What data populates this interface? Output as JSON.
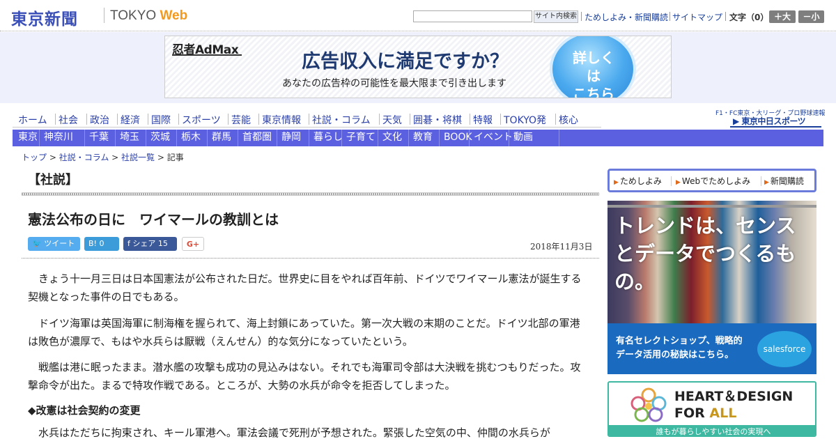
{
  "header": {
    "logo_jp": "東京新聞",
    "logo_en": "TOKYO ",
    "logo_web": "Web",
    "search_button": "サイト内検索",
    "links": [
      "ためしよみ・新聞購読",
      "サイトマップ"
    ],
    "font_label": "文字（0）",
    "font_larger": "＋大",
    "font_smaller": "－小"
  },
  "ad_banner": {
    "brand": "忍者AdMax",
    "headline": "広告収入に満足ですか？",
    "subline": "あなたの広告枠の可能性を最大限まで引き出します",
    "cta_line1": "詳しくは",
    "cta_line2": "こちら"
  },
  "nav_primary": [
    "ホーム",
    "社会",
    "政治",
    "経済",
    "国際",
    "スポーツ",
    "芸能",
    "東京情報",
    "社説・コラム",
    "天気",
    "囲碁・将棋",
    "特報",
    "TOKYO発",
    "核心"
  ],
  "chunichi": {
    "tagline": "F1・FC東京・大リーグ・プロ野球速報",
    "logo": "▶ 東京中日スポーツ"
  },
  "nav_secondary": [
    "東京",
    "神奈川",
    "千葉",
    "埼玉",
    "茨城",
    "栃木",
    "群馬",
    "首都圏",
    "静岡",
    "暮らし",
    "子育て",
    "文化",
    "教育",
    "BOOK",
    "イベント",
    "動画"
  ],
  "breadcrumb": {
    "items": [
      "トップ",
      "社説・コラム",
      "社説一覧"
    ],
    "separator": " > ",
    "current": "記事"
  },
  "article": {
    "section": "【社説】",
    "title": "憲法公布の日に　ワイマールの教訓とは",
    "date": "2018年11月3日",
    "share": {
      "tweet": "ツイート",
      "hatena": "B! 0",
      "facebook": "f シェア 15",
      "gplus": "G+"
    },
    "paragraphs": [
      "　きょう十一月三日は日本国憲法が公布された日だ。世界史に目をやれば百年前、ドイツでワイマール憲法が誕生する契機となった事件の日でもある。",
      "　ドイツ海軍は英国海軍に制海権を握られて、海上封鎖にあっていた。第一次大戦の末期のことだ。ドイツ北部の軍港は敗色が濃厚で、もはや水兵らは厭戦（えんせん）的な気分になっていたという。",
      "　戦艦は港に眠ったまま。潜水艦の攻撃も成功の見込みはない。それでも海軍司令部は大決戦を挑むつもりだった。攻撃命令が出た。まるで特攻作戦である。ところが、大勢の水兵が命令を拒否してしまった。",
      "　水兵はただちに拘束され、キール軍港へ。軍法会議で死刑が予想された。緊張した空気の中、仲間の水兵らが"
    ],
    "subheading": "◆改憲は社会契約の変更"
  },
  "sidebar": {
    "tabs": [
      "ためしよみ",
      "Webでためしよみ",
      "新聞購読"
    ],
    "ad_trend": {
      "headline": "トレンドは、センスとデータでつくるもの。",
      "body": "有名セレクトショップ、戦略的データ活用の秘訣はこちら。",
      "brand": "salesforce"
    },
    "ad_heart": {
      "line1": "HEART＆DESIGN",
      "line2_a": "FOR ",
      "line2_b": "ALL",
      "bar": "誰もが暮らしやすい社会の実現へ"
    }
  },
  "colors": {
    "logo_blue": "#3a4fb8",
    "nav_bar": "#5a60e0",
    "link_blue": "#2a3fa8",
    "web_orange": "#f39a1e"
  }
}
